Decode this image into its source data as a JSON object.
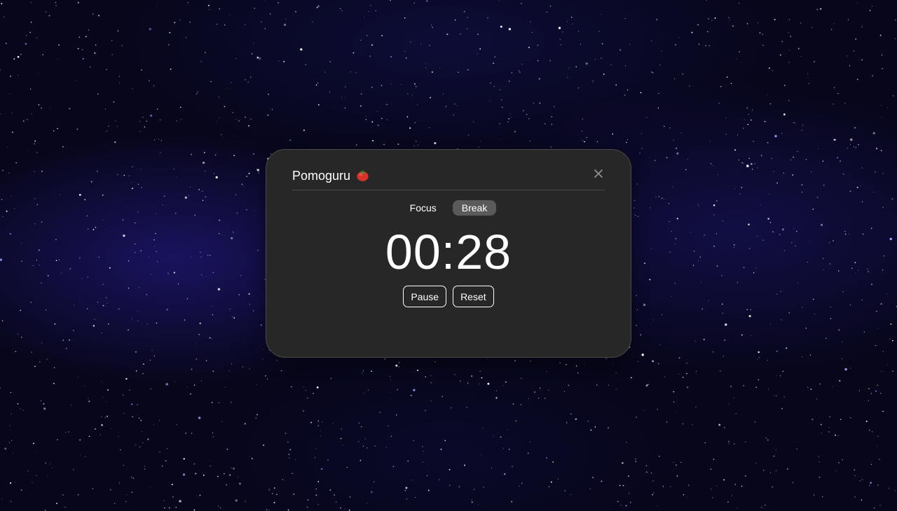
{
  "app": {
    "title": "Pomoguru"
  },
  "tabs": [
    {
      "label": "Focus",
      "active": false
    },
    {
      "label": "Break",
      "active": true
    }
  ],
  "timer": {
    "display": "00:28"
  },
  "controls": {
    "pause_label": "Pause",
    "reset_label": "Reset"
  },
  "icons": {
    "app_icon": "tomato-icon",
    "close_icon": "close-icon"
  },
  "colors": {
    "panel_background": "#272727",
    "active_tab_background": "#5a5a5a",
    "text": "#ffffff",
    "sky_background": "#07061a",
    "tomato": "#d8332a"
  }
}
